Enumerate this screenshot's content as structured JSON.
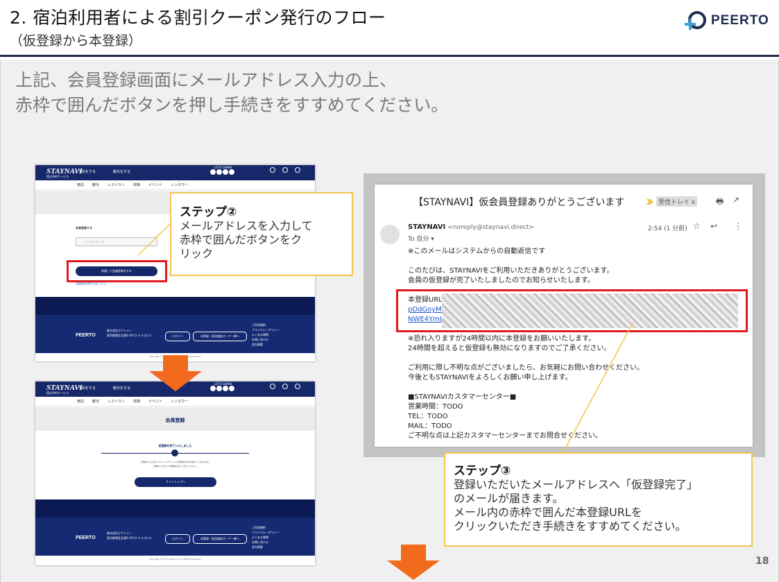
{
  "slide": {
    "title": "2. 宿泊利用者による割引クーポン発行のフロー",
    "subtitle": "（仮登録から本登録）",
    "lead_lines": [
      "上記、会員登録画面にメールアドレス入力の上、",
      "赤枠で囲んだボタンを押し手続きをすすめてください。"
    ],
    "page_number": "18"
  },
  "logo": {
    "text": "PEERTO"
  },
  "colors": {
    "navy": "#16286a",
    "highlight_red": "#e0191f",
    "callout_border": "#f2c44c",
    "arrow_orange": "#f26b1d"
  },
  "site": {
    "brand": "STAYNAVI",
    "brand_sub": "宿泊予約サービス",
    "share_label": "LET'S SHARE",
    "header_links": [
      "予約をする",
      "観光をする"
    ],
    "header_icons": [
      "はじめての方",
      "会員登録",
      "ログイン"
    ],
    "subnav": [
      "宿泊",
      "観光",
      "レストラン",
      "体験",
      "イベント",
      "レンタカー"
    ],
    "form_label": "会員登録する",
    "email_placeholder": "メールアドレス",
    "submit_label": "同意して会員登録をする",
    "login_prompt": "会員登録済の方はこちら",
    "complete_title": "会員登録",
    "complete_message": "仮登録を完了いたしました",
    "complete_note_1": "ご登録いただきましたメールアドレスに本登録URLをお送りしております。",
    "complete_note_2": "ご確認いただき、本登録を完了させてください。",
    "top_button": "サイトトップへ",
    "footer_company": "株式会社ピアトゥー",
    "footer_address": "東京都港区芝浦3-19-12 テラスビル",
    "footer_buttons": [
      "ログイン",
      "本登録・宿泊施設オーナー様へ"
    ],
    "footer_links": [
      "ご利用規約",
      "プライバシーポリシー",
      "よくある質問",
      "お問い合わせ",
      "会社概要"
    ],
    "copyright": "Copyright © 2021 Peerto Inc. All Rights Reserved."
  },
  "callouts": {
    "step2": {
      "title": "ステップ②",
      "lines": [
        "メールアドレスを入力して",
        "赤枠で囲んだボタンをク",
        "リック"
      ]
    },
    "step3": {
      "title": "ステップ③",
      "lines": [
        "登録いただいたメールアドレスへ「仮登録完了」",
        "のメールが届きます。",
        "メール内の赤枠で囲んだ本登録URLを",
        "クリックいただき手続きをすすめてください。"
      ]
    }
  },
  "email": {
    "subject": "【STAYNAVI】仮会員登録ありがとうございます",
    "label_tag": "受信トレイ x",
    "sender_name": "STAYNAVI",
    "sender_address": "<noreply@staynavi.direct>",
    "to": "To 自分 ▾",
    "time": "2:54 (1 分前)",
    "body_lines": [
      "※このメールはシステムからの自動返信です",
      "",
      "このたびは、STAYNAVIをご利用いただきありがとうございます。",
      "会員の仮登録が完了いたしましたのでお知らせいたします。",
      "",
      "本登録URL：",
      "pDdGoyMXc",
      "NWE4YmU2",
      "",
      "※恐れ入りますが24時間以内に本登録をお願いいたします。",
      "24時間を超えると仮登録も無効になりますのでご了承ください。",
      "",
      "ご利用に際し不明な点がございましたら、お気軽にお問い合わせください。",
      "今後ともSTAYNAVIをよろしくお願い申し上げます。",
      "",
      "■STAYNAVIカスタマーセンター■",
      "営業時間：TODO",
      "TEL：TODO",
      "MAIL：TODO",
      "ご不明な点は上記カスタマーセンターまでお問合せください。"
    ]
  }
}
